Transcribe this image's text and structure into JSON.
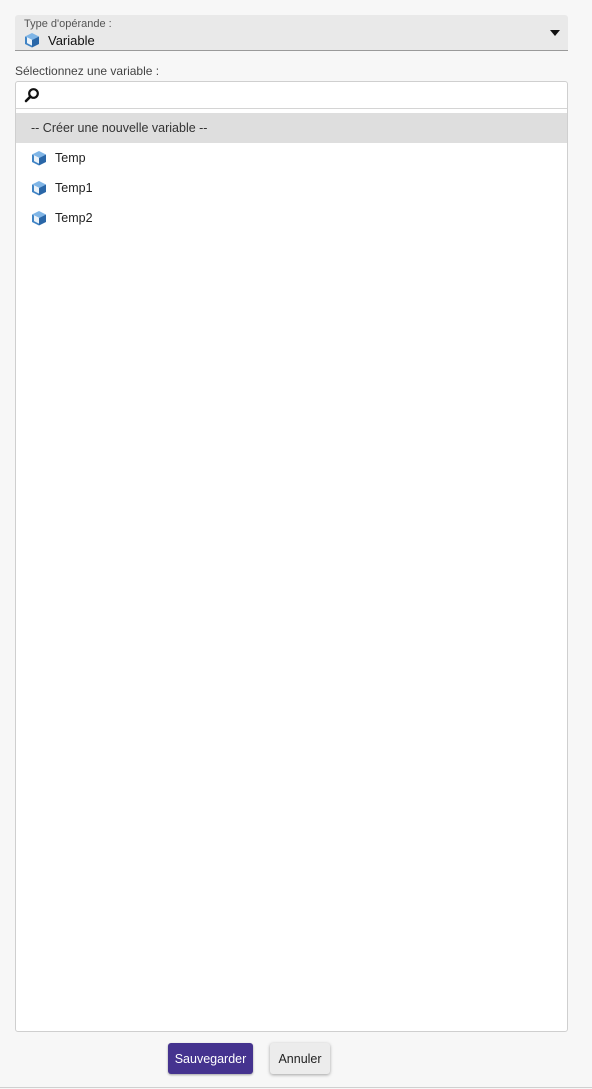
{
  "operand_type": {
    "label": "Type d'opérande :",
    "value": "Variable",
    "icon": "cube-icon"
  },
  "variable_select": {
    "label": "Sélectionnez une variable :",
    "search_value": "",
    "search_icon": "search-icon",
    "create_item": "-- Créer une nouvelle variable --",
    "items": [
      {
        "name": "Temp",
        "icon": "cube-icon"
      },
      {
        "name": "Temp1",
        "icon": "cube-icon"
      },
      {
        "name": "Temp2",
        "icon": "cube-icon"
      }
    ]
  },
  "actions": {
    "save_label": "Sauvegarder",
    "cancel_label": "Annuler"
  },
  "colors": {
    "primary": "#45338f",
    "icon_blue": "#3f83c4",
    "selected_row": "#dedede"
  }
}
